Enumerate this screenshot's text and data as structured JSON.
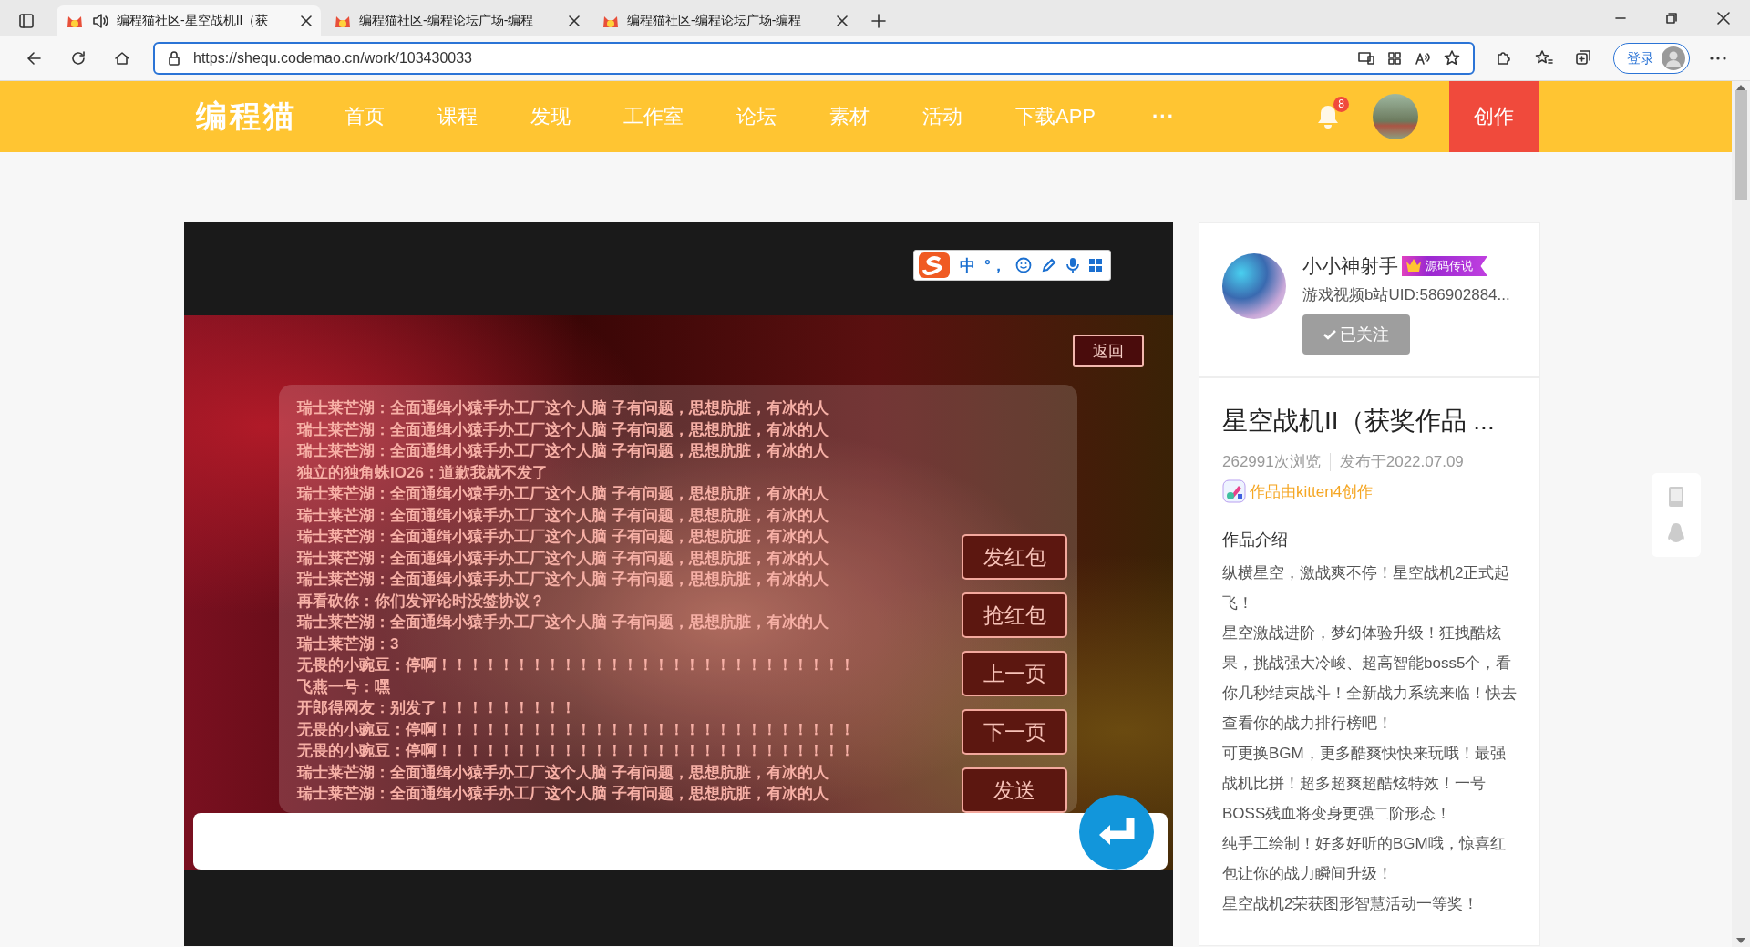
{
  "browser": {
    "tabs": [
      {
        "title": "编程猫社区-星空战机II（获",
        "selected": true,
        "audio": true
      },
      {
        "title": "编程猫社区-编程论坛广场-编程",
        "selected": false,
        "audio": false
      },
      {
        "title": "编程猫社区-编程论坛广场-编程",
        "selected": false,
        "audio": false
      }
    ],
    "url": "https://shequ.codemao.cn/work/103430033",
    "login_button": "登录"
  },
  "nav": {
    "logo": "编程猫",
    "items": [
      "首页",
      "课程",
      "发现",
      "工作室",
      "论坛",
      "素材",
      "活动",
      "下载APP"
    ],
    "more": "···",
    "notification_count": "8",
    "create_button": "创作"
  },
  "game": {
    "back_button": "返回",
    "messages": [
      "瑞士莱芒湖：全面通缉小猿手办工厂这个人脑 子有问题，思想肮脏，有冰的人",
      "瑞士莱芒湖：全面通缉小猿手办工厂这个人脑 子有问题，思想肮脏，有冰的人",
      "瑞士莱芒湖：全面通缉小猿手办工厂这个人脑 子有问题，思想肮脏，有冰的人",
      "独立的独角蛛IO26：道歉我就不发了",
      "瑞士莱芒湖：全面通缉小猿手办工厂这个人脑 子有问题，思想肮脏，有冰的人",
      "瑞士莱芒湖：全面通缉小猿手办工厂这个人脑 子有问题，思想肮脏，有冰的人",
      "瑞士莱芒湖：全面通缉小猿手办工厂这个人脑 子有问题，思想肮脏，有冰的人",
      "瑞士莱芒湖：全面通缉小猿手办工厂这个人脑 子有问题，思想肮脏，有冰的人",
      "瑞士莱芒湖：全面通缉小猿手办工厂这个人脑 子有问题，思想肮脏，有冰的人",
      "再看砍你：你们发评论时没签协议？",
      "瑞士莱芒湖：全面通缉小猿手办工厂这个人脑 子有问题，思想肮脏，有冰的人",
      "瑞士莱芒湖：3",
      "无畏的小豌豆：停啊！！！！！！！！！！！！！！！！！！！！！！！！！！！",
      "飞燕一号：嘿",
      "开郎得网友：别发了！！！！！！！！！",
      "无畏的小豌豆：停啊！！！！！！！！！！！！！！！！！！！！！！！！！！！",
      "无畏的小豌豆：停啊！！！！！！！！！！！！！！！！！！！！！！！！！！！",
      "瑞士莱芒湖：全面通缉小猿手办工厂这个人脑 子有问题，思想肮脏，有冰的人",
      "瑞士莱芒湖：全面通缉小猿手办工厂这个人脑 子有问题，思想肮脏，有冰的人"
    ],
    "buttons": [
      "发红包",
      "抢红包",
      "上一页",
      "下一页",
      "发送"
    ]
  },
  "ime_toolbar": {
    "items": [
      "中",
      "°，"
    ]
  },
  "author": {
    "name": "小小神射手",
    "badge": "源码传说",
    "bio": "游戏视频b站UID:586902884...",
    "follow_button": "已关注",
    "followed": true
  },
  "work": {
    "title": "星空战机II（获奖作品 ...",
    "views": "262991次浏览",
    "published": "发布于2022.07.09",
    "tool": "作品由kitten4创作",
    "intro_heading": "作品介绍",
    "description": [
      "纵横星空，激战爽不停！星空战机2正式起飞！",
      "星空激战进阶，梦幻体验升级！狂拽酷炫",
      "果，挑战强大冷峻、超高智能boss5个，看你几秒结束战斗！全新战力系统来临！快去查看你的战力排行榜吧！",
      "可更换BGM，更多酷爽快快来玩哦！最强战机比拼！超多超爽超酷炫特效！一号BOSS残血将变身更强二阶形态！",
      "纯手工绘制！好多好听的BGM哦，惊喜红包让你的战力瞬间升级！",
      "星空战机2荣获图形智慧活动一等奖！"
    ]
  }
}
